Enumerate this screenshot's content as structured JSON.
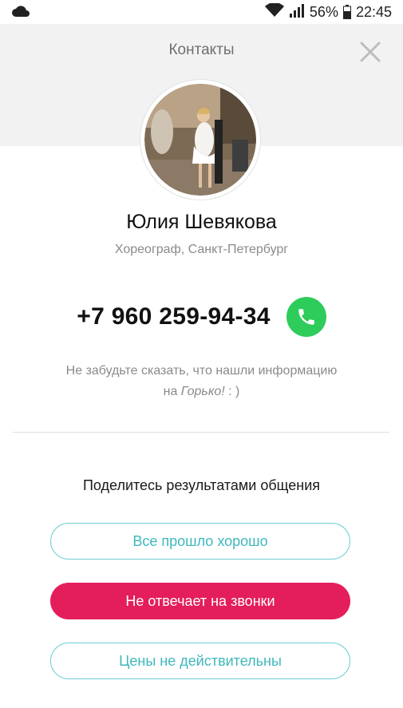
{
  "status_bar": {
    "battery": "56%",
    "time": "22:45"
  },
  "header": {
    "title": "Контакты"
  },
  "contact": {
    "name": "Юлия Шевякова",
    "subtitle": "Хореограф, Санкт-Петербург",
    "phone": "+7 960 259-94-34"
  },
  "reminder": {
    "line1": "Не забудьте сказать, что нашли информацию",
    "prefix": "на ",
    "brand": "Горько!",
    "suffix": " : )"
  },
  "feedback": {
    "title": "Поделитесь результатами общения",
    "buttons": [
      {
        "label": "Все прошло хорошо"
      },
      {
        "label": "Не отвечает на звонки"
      },
      {
        "label": "Цены не действительны"
      }
    ]
  },
  "colors": {
    "accent_teal": "#3fb8bc",
    "accent_pink": "#e41e5b",
    "call_green": "#2ecc5b"
  }
}
